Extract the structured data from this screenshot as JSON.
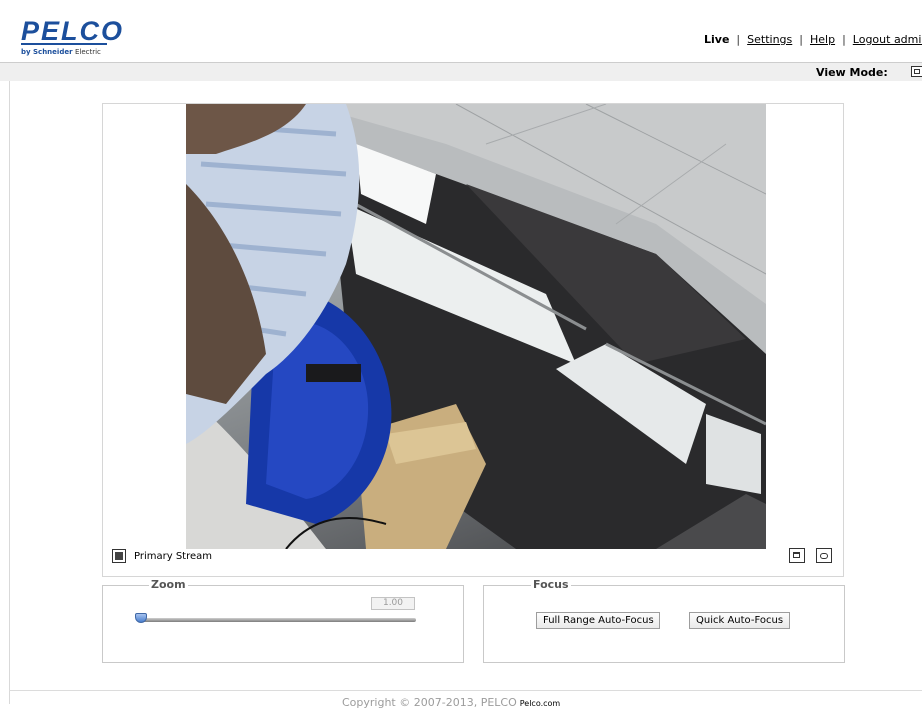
{
  "header": {
    "logo_text": "PELCO",
    "logo_sub_brand": "by Schneider",
    "logo_sub_suffix": "Electric",
    "nav": {
      "live": "Live",
      "settings": "Settings",
      "help": "Help",
      "logout": "Logout admin",
      "separator": "|"
    },
    "view_mode_label": "View Mode:"
  },
  "video": {
    "stream_label": "Primary Stream",
    "icons": [
      "stream-settings-icon",
      "popout-window-icon",
      "snapshot-camera-icon"
    ]
  },
  "zoom": {
    "legend": "Zoom",
    "value": "1.00",
    "slider_fraction": 0
  },
  "focus": {
    "legend": "Focus",
    "full_range_label": "Full Range Auto-Focus",
    "quick_label": "Quick Auto-Focus"
  },
  "footer": {
    "copyright": "Copyright © 2007-2013, PELCO",
    "link_text": "Pelco.com"
  },
  "colors": {
    "brand": "#1c4f9c",
    "subbar": "#efefef",
    "slider_thumb": "#4a7fcf"
  }
}
